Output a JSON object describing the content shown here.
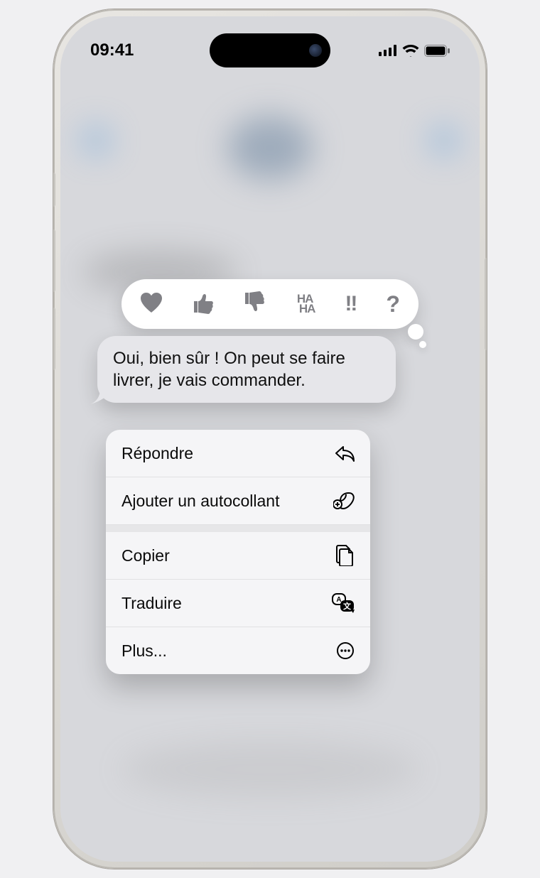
{
  "status": {
    "time": "09:41"
  },
  "tapback": {
    "heart": "heart",
    "thumbs_up": "thumbs-up",
    "thumbs_down": "thumbs-down",
    "haha_top": "HA",
    "haha_bottom": "HA",
    "exclaim": "!!",
    "question": "?"
  },
  "message": {
    "text": "Oui, bien sûr ! On peut se faire livrer, je vais commander."
  },
  "menu": {
    "reply": "Répondre",
    "sticker": "Ajouter un autocollant",
    "copy": "Copier",
    "translate": "Traduire",
    "more": "Plus..."
  }
}
